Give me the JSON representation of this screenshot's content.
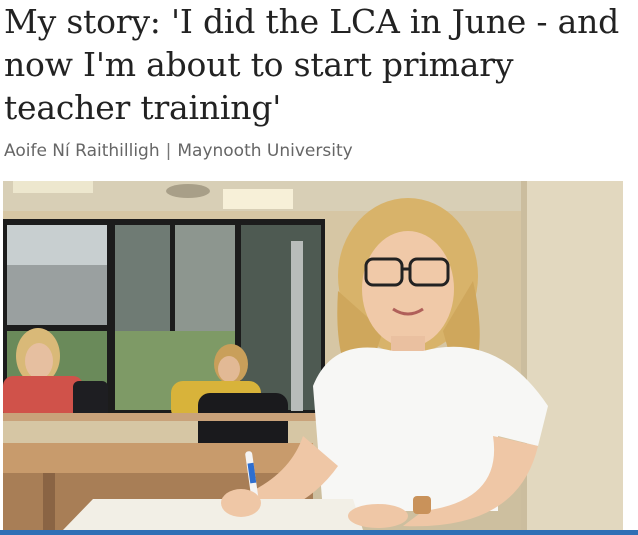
{
  "article": {
    "headline": "My story: 'I did the LCA in June - and now I'm about to start primary teacher training'",
    "author": "Aoife Ní Raithilligh",
    "separator": "|",
    "organisation": "Maynooth University"
  },
  "photo": {
    "subject": "student-at-desk-holding-pen"
  },
  "colors": {
    "headline": "#222222",
    "byline": "#666666",
    "accent_bar": "#2f6fb5"
  }
}
